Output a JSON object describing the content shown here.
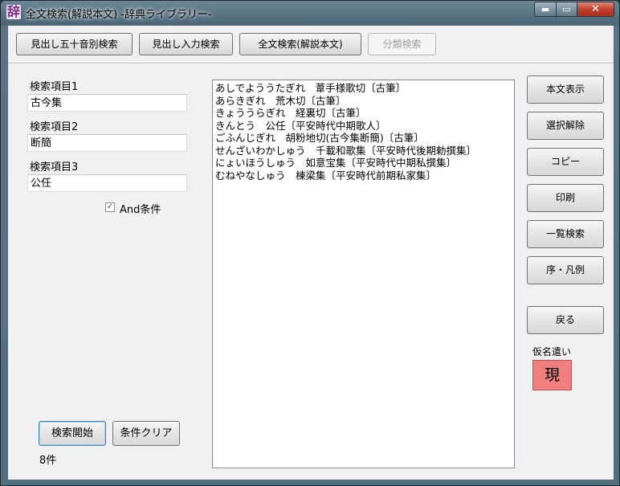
{
  "window": {
    "app_icon_glyph": "辞",
    "title": "全文検索(解説本文) -辞典ライブラリー-",
    "minimize_glyph": "▬",
    "maximize_glyph": "▭",
    "close_glyph": "✕"
  },
  "toolbar": {
    "buttons": [
      {
        "label": "見出し五十音別検索",
        "enabled": true
      },
      {
        "label": "見出し入力検索",
        "enabled": true
      },
      {
        "label": "全文検索(解説本文)",
        "enabled": true
      },
      {
        "label": "分類検索",
        "enabled": false
      }
    ]
  },
  "search": {
    "item1_label": "検索項目1",
    "item1_value": "古今集",
    "item2_label": "検索項目2",
    "item2_value": "断簡",
    "item3_label": "検索項目3",
    "item3_value": "公任",
    "and_label": "And条件",
    "and_checked": true,
    "and_check_glyph": "✓",
    "start_label": "検索開始",
    "clear_label": "条件クリア",
    "count": "8件"
  },
  "results": [
    "あしでよううたぎれ　葦手様歌切〔古筆〕",
    "あらきぎれ　荒木切〔古筆〕",
    "きょううらぎれ　経裏切〔古筆〕",
    "きんとう　公任〔平安時代中期歌人〕",
    "ごふんじぎれ　胡粉地切(古今集断簡)〔古筆〕",
    "せんざいわかしゅう　千載和歌集〔平安時代後期勅撰集〕",
    "にょいほうしゅう　如意宝集〔平安時代中期私撰集〕",
    "むねやなしゅう　棟梁集〔平安時代前期私家集〕"
  ],
  "side": {
    "show_text": "本文表示",
    "deselect": "選択解除",
    "copy": "コピー",
    "print": "印刷",
    "list_search": "一覧検索",
    "preface": "序・凡例",
    "back": "戻る",
    "kana_label": "仮名遣い",
    "kana_value": "現"
  },
  "colors": {
    "kana_box": "#f08080",
    "close_button": "#c4402c"
  }
}
